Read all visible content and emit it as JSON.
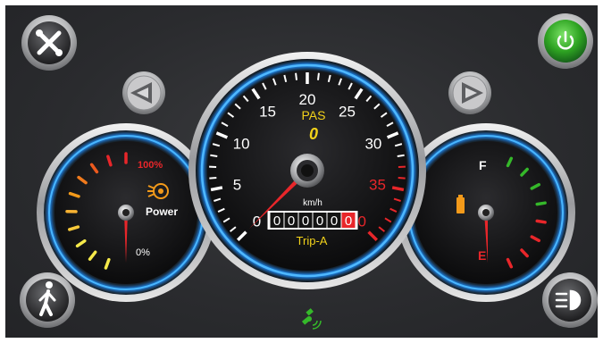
{
  "speedometer": {
    "pas_label": "PAS",
    "pas_level": "0",
    "unit": "km/h",
    "scale": [
      "0",
      "5",
      "10",
      "15",
      "20",
      "25",
      "30",
      "35",
      "40"
    ],
    "speed_value": 0,
    "max_speed": 40,
    "odometer_digits": [
      "0",
      "0",
      "0",
      "0",
      "0",
      "0"
    ],
    "trip_label": "Trip-A"
  },
  "power_gauge": {
    "max_label": "100%",
    "min_label": "0%",
    "title": "Power",
    "value_percent": 0
  },
  "fuel_gauge": {
    "full_label": "F",
    "empty_label": "E",
    "level_percent": 0
  },
  "buttons": {
    "settings_icon": "wrench-screwdriver-icon",
    "power_icon": "power-icon",
    "walk_icon": "walking-person-icon",
    "headlight_icon": "headlight-icon",
    "left_icon": "left-arrow-icon",
    "right_icon": "right-arrow-icon",
    "gps_icon": "gps-satellite-icon"
  },
  "colors": {
    "accent_blue": "#1e8fff",
    "warning_red": "#e8262a",
    "pas_yellow": "#f2d21a",
    "power_green": "#35b82a",
    "fuel_orange": "#f39a1a"
  }
}
